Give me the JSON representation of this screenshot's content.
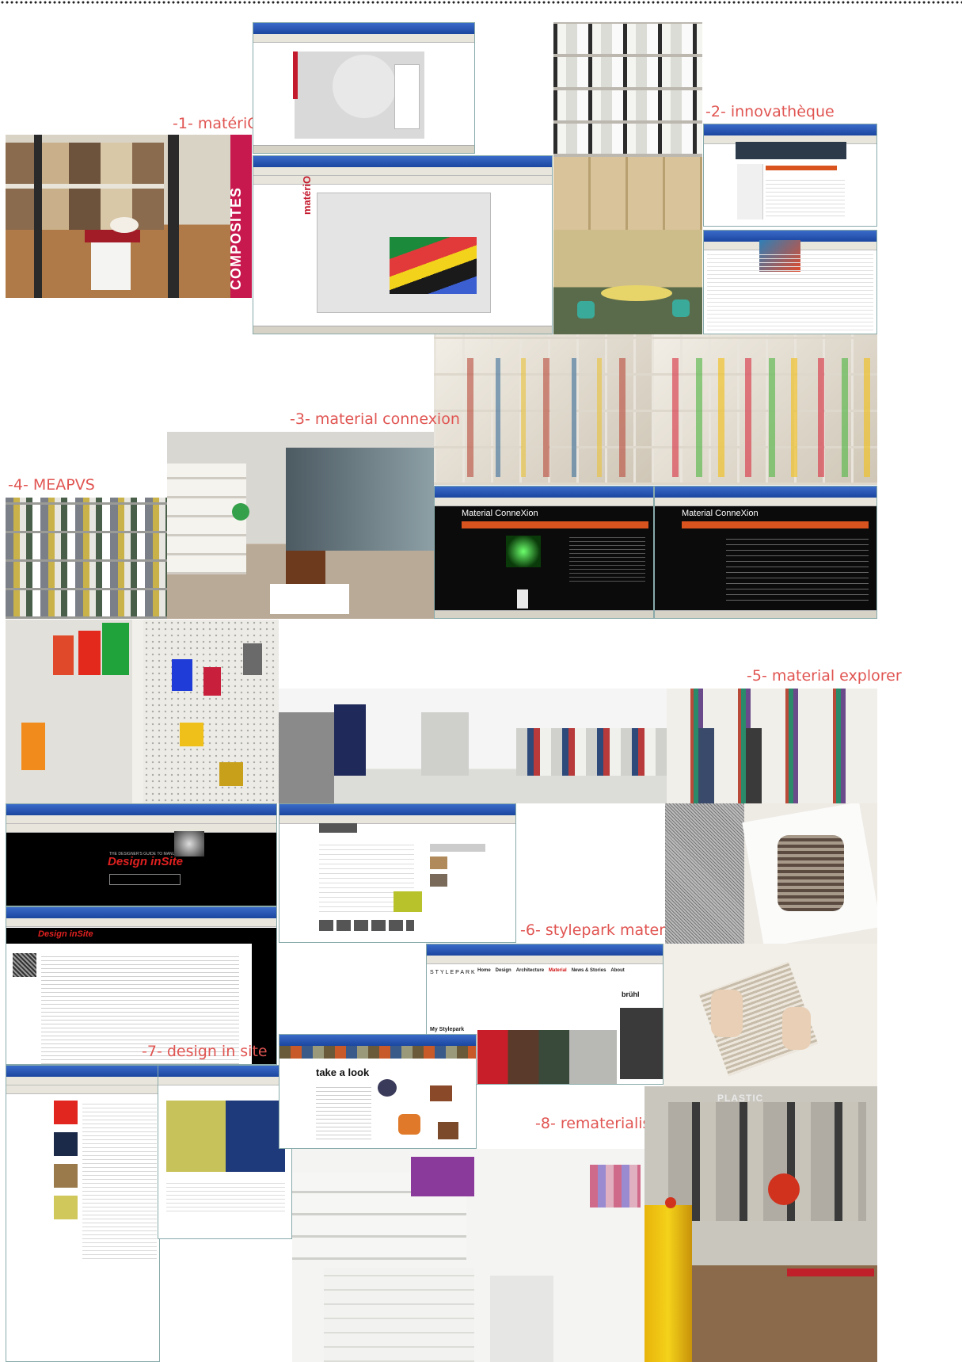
{
  "labels": {
    "materio": "-1- matériO",
    "innovatheque": "-2- innovathèque",
    "material_connexion": "-3- material connexion",
    "meapvs": "-4- MEAPVS",
    "material_explorer": "-5- material explorer",
    "stylepark": "-6- stylepark materials",
    "design_in_site": "-7- design in site",
    "rematerialise": "-8- rematerialise"
  },
  "materio_screen": {
    "logo": "matériO"
  },
  "photo_text": {
    "composites": "COMPOSITES",
    "plastic": "PLASTIC"
  },
  "material_connexion_screen": {
    "logo": "Material ConneXion"
  },
  "design_insite_screen": {
    "tagline": "THE DESIGNER'S GUIDE TO MANUFACTURING",
    "title": "Design inSite"
  },
  "stylepark_screen": {
    "logo": "STYLEPARK",
    "nav": [
      "Home",
      "Design",
      "Architecture",
      "Material",
      "News & Stories",
      "About"
    ],
    "brand": "brühl",
    "section": "My Stylepark"
  },
  "rematerialise_screen": {
    "heading": "take a look"
  },
  "colors": {
    "label": "#e05552",
    "mc_orange": "#d9531e",
    "dis_red": "#e02020"
  }
}
